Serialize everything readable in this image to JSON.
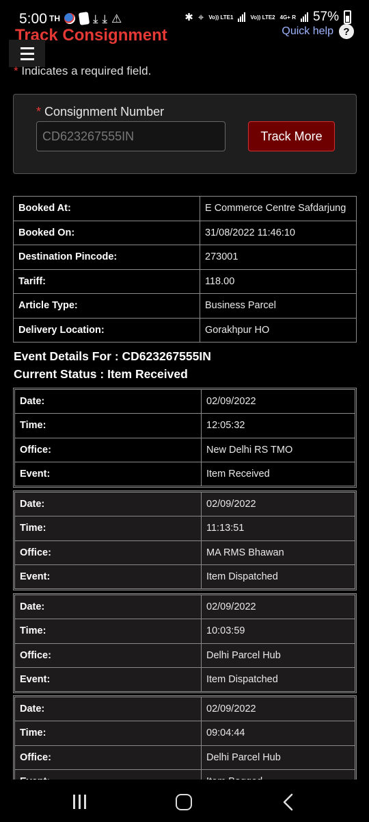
{
  "status_bar": {
    "time": "5:00",
    "carrier_tag": "TH",
    "volte1": "Vo)) LTE1",
    "volte2": "Vo)) LTE2",
    "network": "4G+ R",
    "battery": "57%"
  },
  "header": {
    "title": "Track Consignment",
    "quick_help": "Quick help",
    "help_icon": "help-icon"
  },
  "required_note": {
    "star": "*",
    "text": " Indicates a required field."
  },
  "form": {
    "label_star": "*",
    "label": " Consignment Number",
    "consignment_value": "CD623267555IN",
    "track_button": "Track More"
  },
  "booking_details": [
    {
      "key": "Booked At:",
      "value": "E Commerce Centre Safdarjung"
    },
    {
      "key": "Booked On:",
      "value": "31/08/2022 11:46:10"
    },
    {
      "key": "Destination Pincode:",
      "value": "273001"
    },
    {
      "key": "Tariff:",
      "value": "118.00"
    },
    {
      "key": "Article Type:",
      "value": "Business Parcel"
    },
    {
      "key": "Delivery Location:",
      "value": "Gorakhpur HO"
    }
  ],
  "event_heading": "Event Details For : CD623267555IN",
  "current_status": "Current Status : Item Received",
  "labels": {
    "date": "Date:",
    "time": "Time:",
    "office": "Office:",
    "event": "Event:"
  },
  "events": [
    {
      "date": "02/09/2022",
      "time": "12:05:32",
      "office": "New Delhi RS TMO",
      "event": "Item Received"
    },
    {
      "date": "02/09/2022",
      "time": "11:13:51",
      "office": "MA RMS Bhawan",
      "event": "Item Dispatched"
    },
    {
      "date": "02/09/2022",
      "time": "10:03:59",
      "office": "Delhi Parcel Hub",
      "event": "Item Dispatched"
    },
    {
      "date": "02/09/2022",
      "time": "09:04:44",
      "office": "Delhi Parcel Hub",
      "event": "Item Bagged"
    }
  ],
  "nav": {
    "recents_icon": "recents-icon",
    "home_icon": "home-icon",
    "back_icon": "back-icon"
  }
}
